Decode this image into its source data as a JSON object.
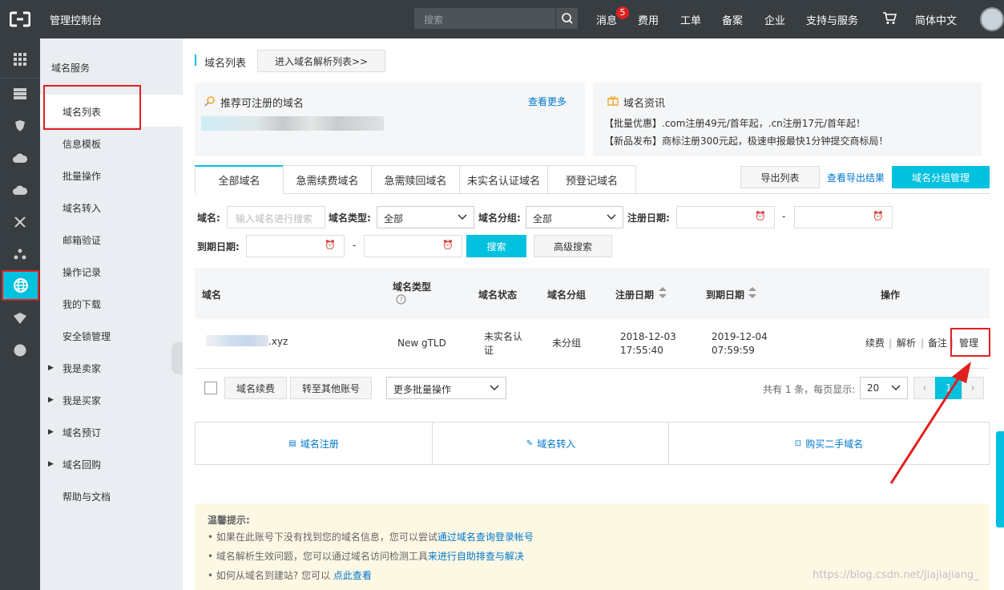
{
  "topbar": {
    "app_title": "管理控制台",
    "search_placeholder": "搜索",
    "nav": [
      "消息",
      "费用",
      "工单",
      "备案",
      "企业",
      "支持与服务",
      "简体中文"
    ],
    "message_count": "5"
  },
  "sidebar": {
    "header": "域名服务",
    "items": [
      "域名列表",
      "信息模板",
      "批量操作",
      "域名转入",
      "邮箱验证",
      "操作记录",
      "我的下载",
      "安全锁管理",
      "我是卖家",
      "我是买家",
      "域名预订",
      "域名回购",
      "帮助与文档"
    ]
  },
  "page": {
    "title": "域名列表",
    "goto_dns_button": "进入域名解析列表>>"
  },
  "recommend": {
    "title": "推荐可注册的域名",
    "more": "查看更多"
  },
  "news": {
    "title": "域名资讯",
    "line1": "【批量优惠】.com注册49元/首年起，.cn注册17元/首年起！",
    "line2": "【新品发布】商标注册300元起，极速申报最快1分钟提交商标局！"
  },
  "tabs": [
    "全部域名",
    "急需续费域名",
    "急需赎回域名",
    "未实名认证域名",
    "预登记域名"
  ],
  "actions": {
    "export": "导出列表",
    "view_export": "查看导出结果",
    "group_manage": "域名分组管理"
  },
  "filters": {
    "domain_label": "域名:",
    "domain_placeholder": "输入域名进行搜索",
    "type_label": "域名类型:",
    "type_value": "全部",
    "group_label": "域名分组:",
    "group_value": "全部",
    "reg_date_label": "注册日期:",
    "exp_date_label": "到期日期:",
    "dash": "-",
    "search": "搜索",
    "advanced": "高级搜索"
  },
  "table": {
    "headers": [
      "域名",
      "域名类型",
      "域名状态",
      "域名分组",
      "注册日期",
      "到期日期",
      "操作"
    ],
    "row": {
      "domain": ".xyz",
      "type": "New gTLD",
      "status": "未实名认证",
      "group": "未分组",
      "reg_date": "2018-12-03",
      "reg_time": "17:55:40",
      "exp_date": "2019-12-04",
      "exp_time": "07:59:59",
      "ops": [
        "续费",
        "解析",
        "备注",
        "管理"
      ]
    }
  },
  "footer": {
    "renew": "域名续费",
    "transfer_account": "转至其他账号",
    "batch": "更多批量操作",
    "summary": "共有 1 条，每页显示:",
    "page_size": "20",
    "current_page": "1"
  },
  "quick": {
    "register": "域名注册",
    "transfer_in": "域名转入",
    "buy": "购买二手域名"
  },
  "tips": {
    "title": "温馨提示:",
    "tip1_a": "• 如果在此账号下没有找到您的域名信息，您可以尝试",
    "tip1_link": "通过域名查询登录帐号",
    "tip2_a": "• 域名解析生效问题，您可以通过域名访问检测工具",
    "tip2_link": "来进行自助排查与解决",
    "tip3_a": "• 如何从域名到建站? 您可以 ",
    "tip3_link": "点此查看"
  },
  "watermark": "https://blog.csdn.net/jiajiajiang_"
}
